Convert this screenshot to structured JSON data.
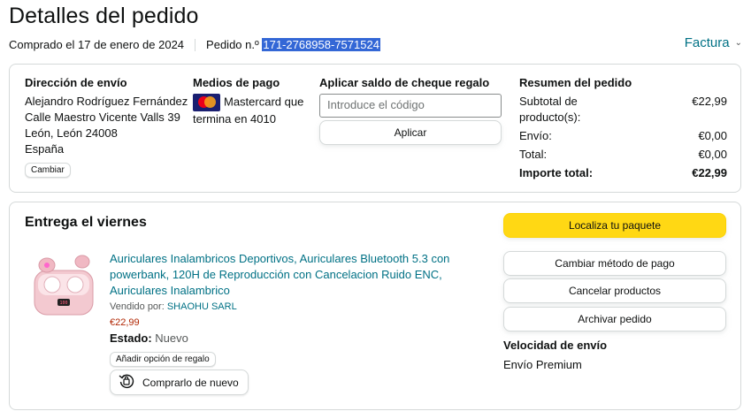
{
  "header": {
    "title": "Detalles del pedido",
    "ordered_on": "Comprado el 17 de enero de 2024",
    "order_label": "Pedido n.º",
    "order_number": "171-2768958-7571524",
    "invoice_label": "Factura"
  },
  "shipping": {
    "title": "Dirección de envío",
    "lines": [
      "Alejandro Rodríguez Fernández",
      "Calle Maestro Vicente Valls 39",
      "León, León 24008",
      "España"
    ],
    "change_label": "Cambiar"
  },
  "payment": {
    "title": "Medios de pago",
    "line1": "Mastercard que",
    "line2": "termina en 4010",
    "card_icon": "mastercard-icon"
  },
  "gift_card": {
    "title": "Aplicar saldo de cheque regalo",
    "placeholder": "Introduce el código",
    "apply_label": "Aplicar"
  },
  "summary": {
    "title": "Resumen del pedido",
    "rows": [
      {
        "label": "Subtotal de producto(s):",
        "value": "€22,99"
      },
      {
        "label": "Envío:",
        "value": "€0,00"
      },
      {
        "label": "Total:",
        "value": "€0,00"
      },
      {
        "label": "Importe total:",
        "value": "€22,99"
      }
    ]
  },
  "delivery": {
    "title": "Entrega el viernes",
    "product_title": "Auriculares Inalambricos Deportivos, Auriculares Bluetooth 5.3 con powerbank, 120H de Reproducción con Cancelacion Ruido ENC, Auriculares Inalambrico",
    "seller_label": "Vendido por:",
    "seller_name": "SHAOHU SARL",
    "price": "€22,99",
    "status_label": "Estado:",
    "status_value": "Nuevo",
    "gift_option_label": "Añadir opción de regalo",
    "buy_again_label": "Comprarlo de nuevo",
    "actions": [
      "Localiza tu paquete",
      "Cambiar método de pago",
      "Cancelar productos",
      "Archivar pedido"
    ],
    "speed_title": "Velocidad de envío",
    "speed_value": "Envío Premium"
  },
  "colors": {
    "link": "#007185",
    "primary_button": "#ffd814",
    "price": "#b12704",
    "highlight": "#3367d6"
  }
}
